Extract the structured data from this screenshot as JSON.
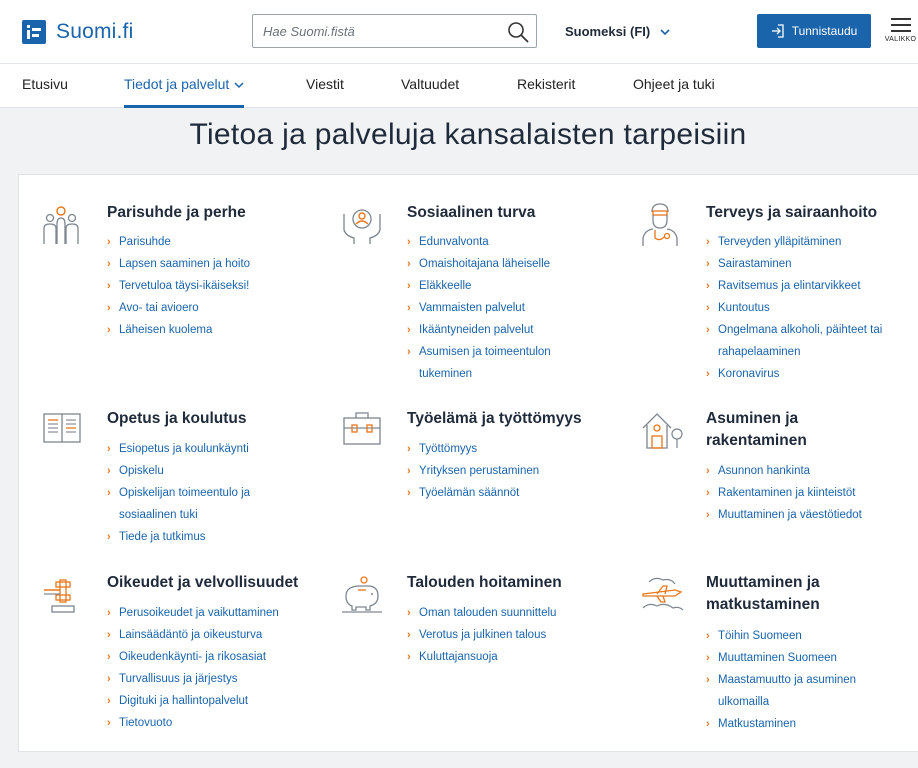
{
  "header": {
    "logo_text": "Suomi.fi",
    "search_placeholder": "Hae Suomi.fistä",
    "language": "Suomeksi (FI)",
    "login_label": "Tunnistaudu",
    "menu_label": "VALIKKO"
  },
  "nav": {
    "items": [
      {
        "label": "Etusivu"
      },
      {
        "label": "Tiedot ja palvelut"
      },
      {
        "label": "Viestit"
      },
      {
        "label": "Valtuudet"
      },
      {
        "label": "Rekisterit"
      },
      {
        "label": "Ohjeet ja tuki"
      }
    ]
  },
  "page": {
    "title": "Tietoa ja palveluja kansalaisten tarpeisiin"
  },
  "categories": [
    {
      "title": "Parisuhde ja perhe",
      "icon": "family-icon",
      "links": [
        "Parisuhde",
        "Lapsen saaminen ja hoito",
        "Tervetuloa täysi-ikäiseksi!",
        "Avo- tai avioero",
        "Läheisen kuolema"
      ]
    },
    {
      "title": "Sosiaalinen turva",
      "icon": "social-security-icon",
      "links": [
        "Edunvalvonta",
        "Omaishoitajana läheiselle",
        "Eläkkeelle",
        "Vammaisten palvelut",
        "Ikääntyneiden palvelut",
        "Asumisen ja toimeentulon",
        "tukeminen"
      ]
    },
    {
      "title": "Terveys ja sairaanhoito",
      "icon": "doctor-icon",
      "links": [
        "Terveyden ylläpitäminen",
        "Sairastaminen",
        "Ravitsemus ja elintarvikkeet",
        "Kuntoutus",
        "Ongelmana alkoholi, päihteet tai",
        "rahapelaaminen",
        "Koronavirus"
      ]
    },
    {
      "title": "Opetus ja koulutus",
      "icon": "book-icon",
      "links": [
        "Esiopetus ja koulunkäynti",
        "Opiskelu",
        "Opiskelijan toimeentulo ja",
        "sosiaalinen tuki",
        "Tiede ja tutkimus"
      ]
    },
    {
      "title": "Työelämä ja työttömyys",
      "icon": "briefcase-icon",
      "links": [
        "Työttömyys",
        "Yrityksen perustaminen",
        "Työelämän säännöt"
      ]
    },
    {
      "title_line1": "Asuminen ja",
      "title_line2": "rakentaminen",
      "icon": "house-icon",
      "links": [
        "Asunnon hankinta",
        "Rakentaminen ja kiinteistöt",
        "Muuttaminen ja väestötiedot"
      ]
    },
    {
      "title": "Oikeudet ja velvollisuudet",
      "icon": "gavel-icon",
      "links": [
        "Perusoikeudet ja vaikuttaminen",
        "Lainsäädäntö ja oikeusturva",
        "Oikeudenkäynti- ja rikosasiat",
        "Turvallisuus ja järjestys",
        "Digituki ja hallintopalvelut",
        "Tietovuoto"
      ]
    },
    {
      "title": "Talouden hoitaminen",
      "icon": "piggy-bank-icon",
      "links": [
        "Oman talouden suunnittelu",
        "Verotus ja julkinen talous",
        "Kuluttajansuoja"
      ]
    },
    {
      "title_line1": "Muuttaminen ja",
      "title_line2": "matkustaminen",
      "icon": "airplane-icon",
      "links": [
        "Töihin Suomeen",
        "Muuttaminen Suomeen",
        "Maastamuutto ja asuminen",
        "ulkomailla",
        "Matkustaminen"
      ]
    }
  ],
  "colors": {
    "brand": "#1a64ab",
    "accent": "#e8771a",
    "text": "#1f2a3a"
  }
}
